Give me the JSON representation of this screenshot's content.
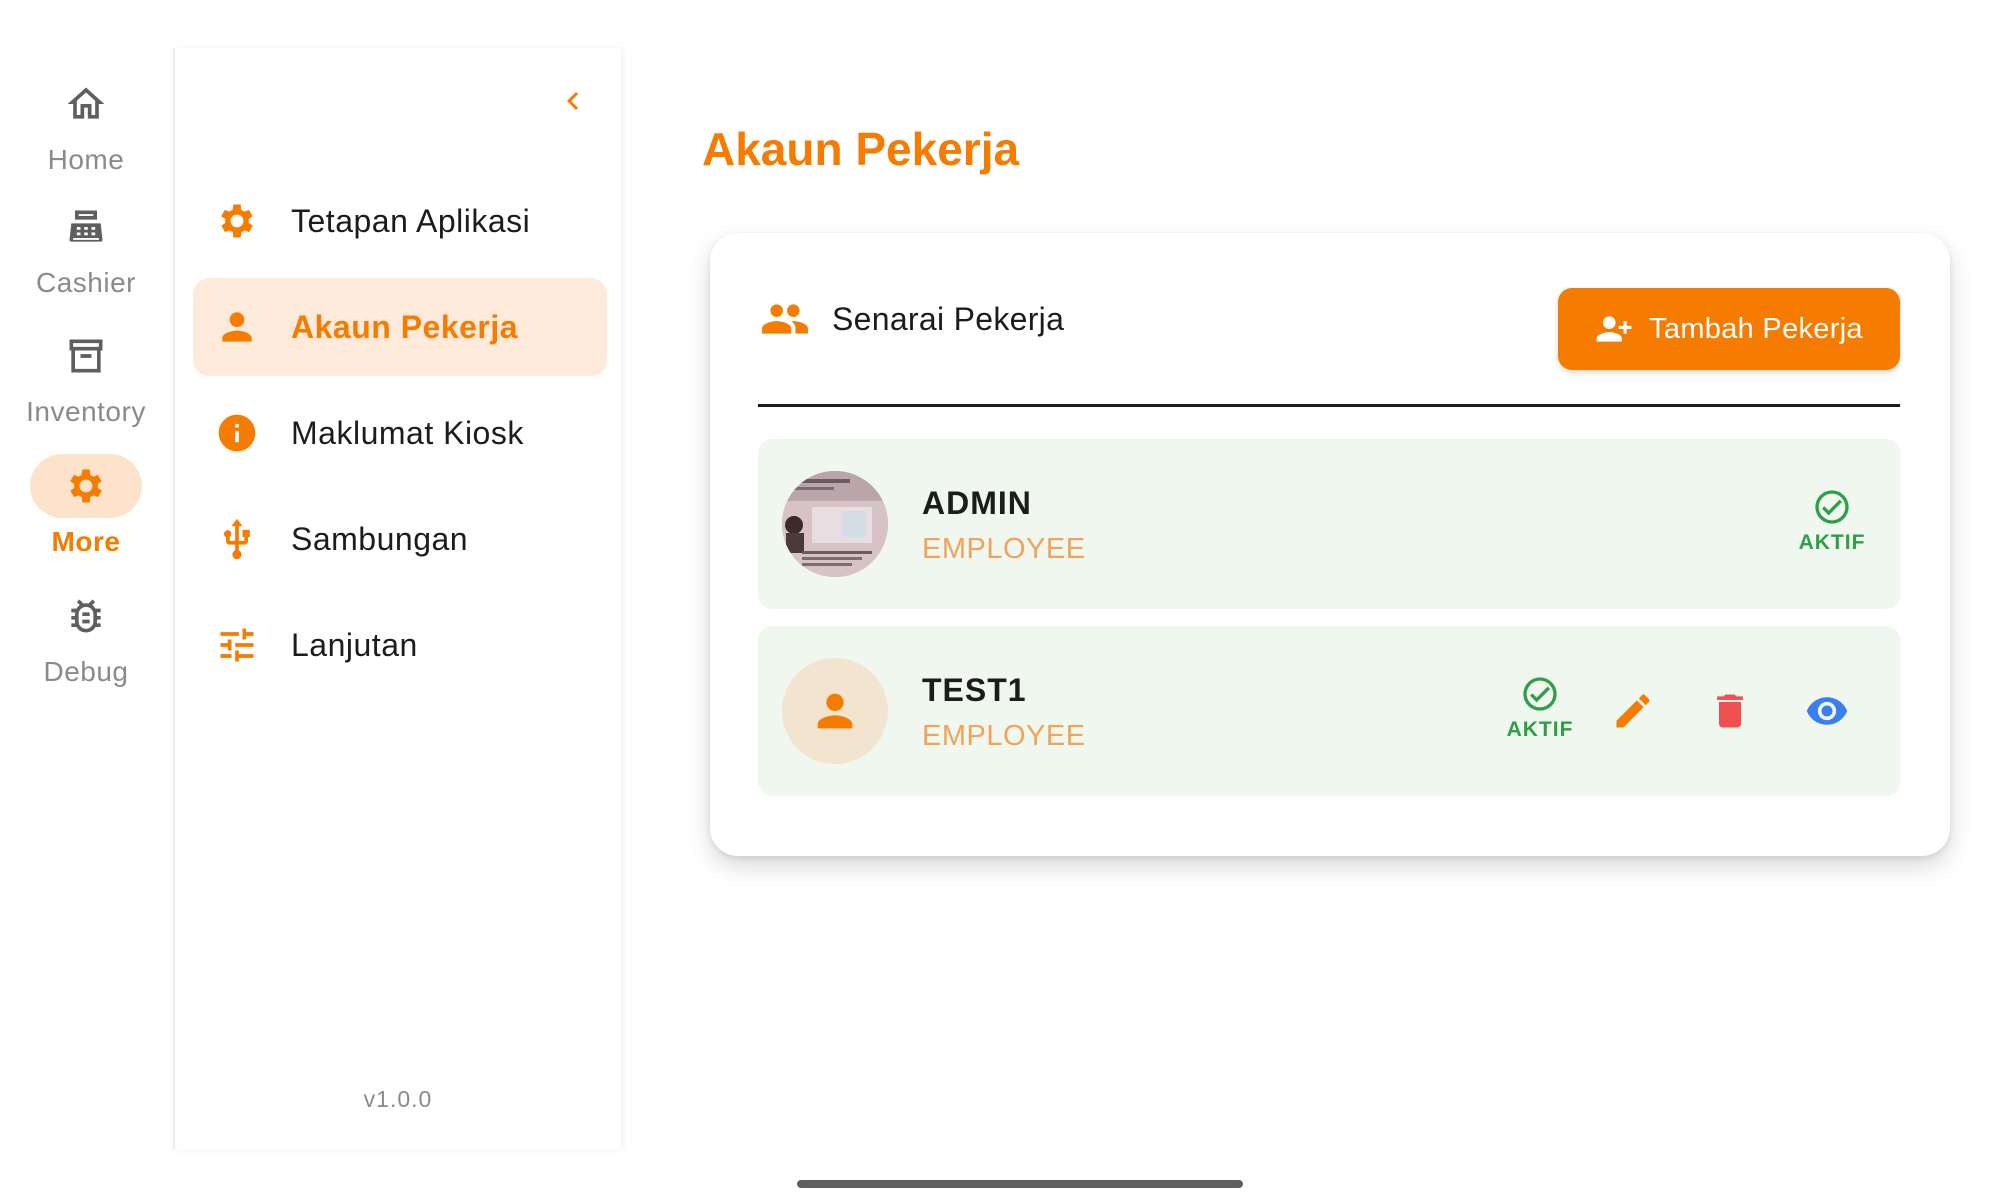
{
  "nav_rail": {
    "items": [
      {
        "label": "Home",
        "icon": "home-icon"
      },
      {
        "label": "Cashier",
        "icon": "cash-register-icon"
      },
      {
        "label": "Inventory",
        "icon": "archive-box-icon"
      },
      {
        "label": "More",
        "icon": "gear-icon",
        "active": true
      },
      {
        "label": "Debug",
        "icon": "bug-icon"
      }
    ]
  },
  "settings_menu": {
    "collapse_icon": "chevron-left-icon",
    "items": [
      {
        "label": "Tetapan Aplikasi",
        "icon": "gear-icon"
      },
      {
        "label": "Akaun Pekerja",
        "icon": "person-icon",
        "active": true
      },
      {
        "label": "Maklumat Kiosk",
        "icon": "info-icon"
      },
      {
        "label": "Sambungan",
        "icon": "usb-icon"
      },
      {
        "label": "Lanjutan",
        "icon": "tune-sliders-icon"
      }
    ],
    "version": "v1.0.0"
  },
  "main": {
    "title": "Akaun Pekerja",
    "card": {
      "title": "Senarai Pekerja",
      "title_icon": "people-icon",
      "add_button_label": "Tambah Pekerja",
      "add_button_icon": "person-add-icon",
      "employees": [
        {
          "name": "ADMIN",
          "role": "EMPLOYEE",
          "status": "AKTIF",
          "avatar": "photo"
        },
        {
          "name": "TEST1",
          "role": "EMPLOYEE",
          "status": "AKTIF",
          "avatar": "person-placeholder",
          "actions": [
            "edit-icon",
            "delete-icon",
            "view-icon"
          ]
        }
      ]
    }
  },
  "colors": {
    "accent": "#f57c00",
    "accent_light": "#fdeadb",
    "row_background": "#f0f7ef",
    "status_active": "#2e9e48",
    "delete": "#f05050",
    "view": "#3a7ef0"
  }
}
